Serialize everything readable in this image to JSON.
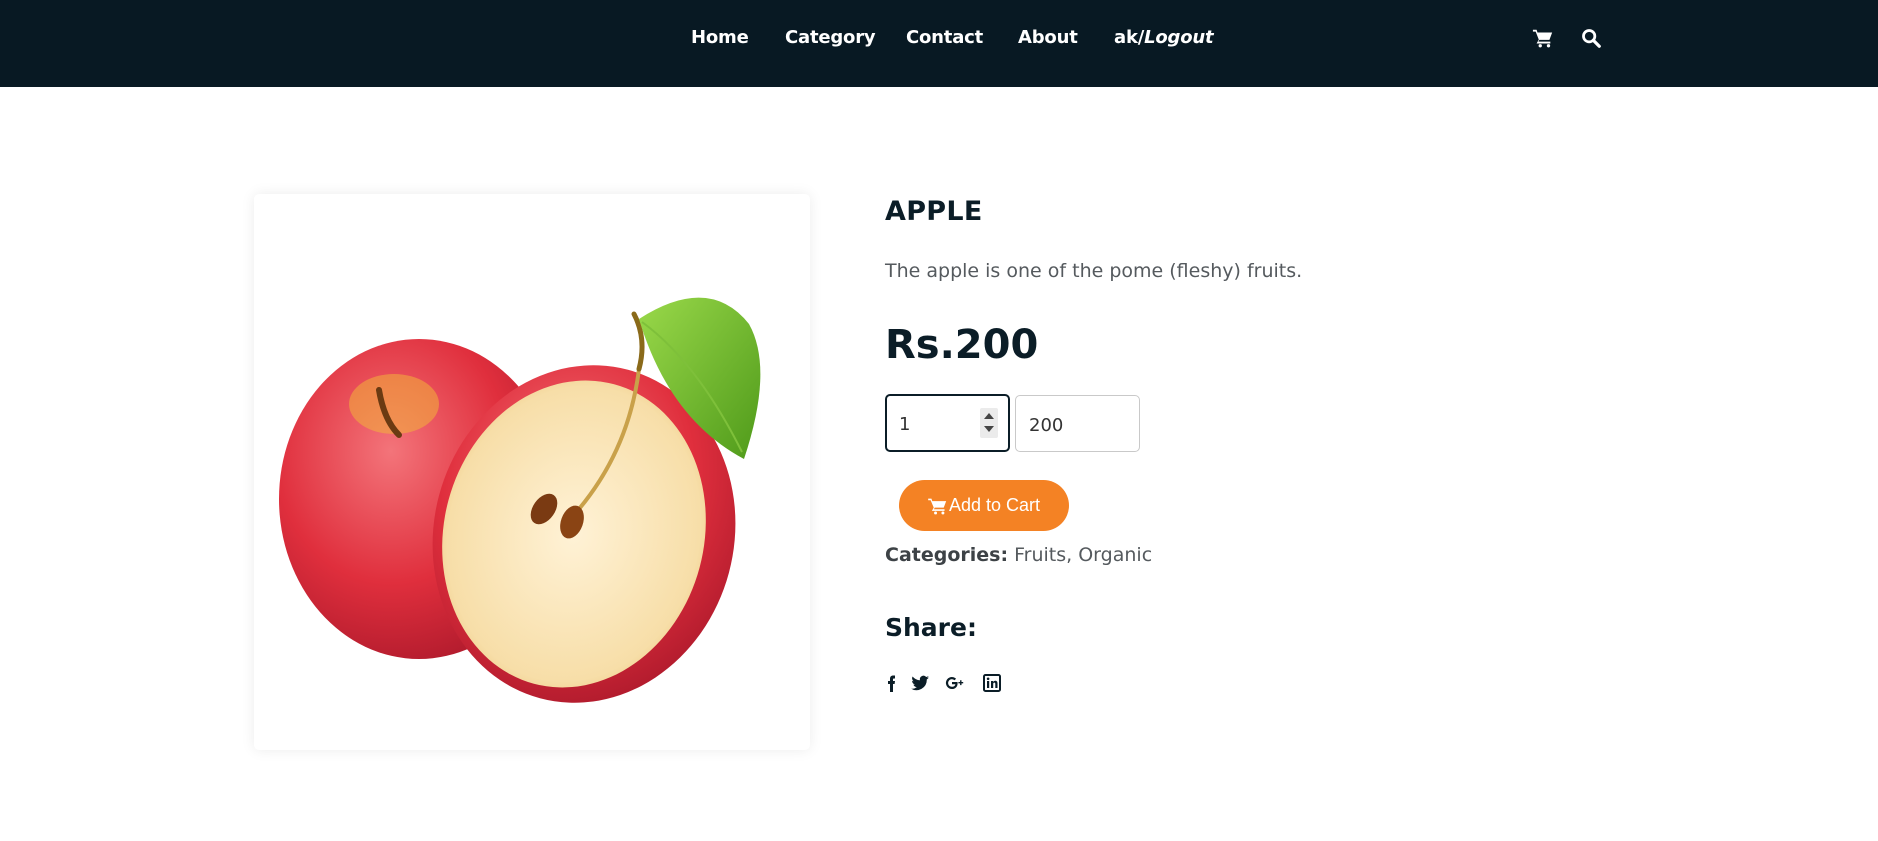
{
  "nav": {
    "items": [
      "Home",
      "Category",
      "Contact",
      "About"
    ],
    "user": "ak/",
    "logout": "Logout"
  },
  "header_icons": [
    "cart-icon",
    "search-icon"
  ],
  "product": {
    "name": "APPLE",
    "description": "The apple is one of the pome (fleshy) fruits.",
    "price": "Rs.200",
    "quantity": "1",
    "total": "200",
    "add_to_cart_label": "Add to Cart",
    "categories_label": "Categories:",
    "categories_value": "Fruits, Organic",
    "image_icon": "apple-image"
  },
  "share": {
    "title": "Share:",
    "icons": [
      "facebook-icon",
      "twitter-icon",
      "google-plus-icon",
      "linkedin-icon"
    ]
  },
  "colors": {
    "header_bg": "#081923",
    "accent": "#f48224",
    "text_dark": "#0b1d27",
    "text_muted": "#555a5e"
  }
}
